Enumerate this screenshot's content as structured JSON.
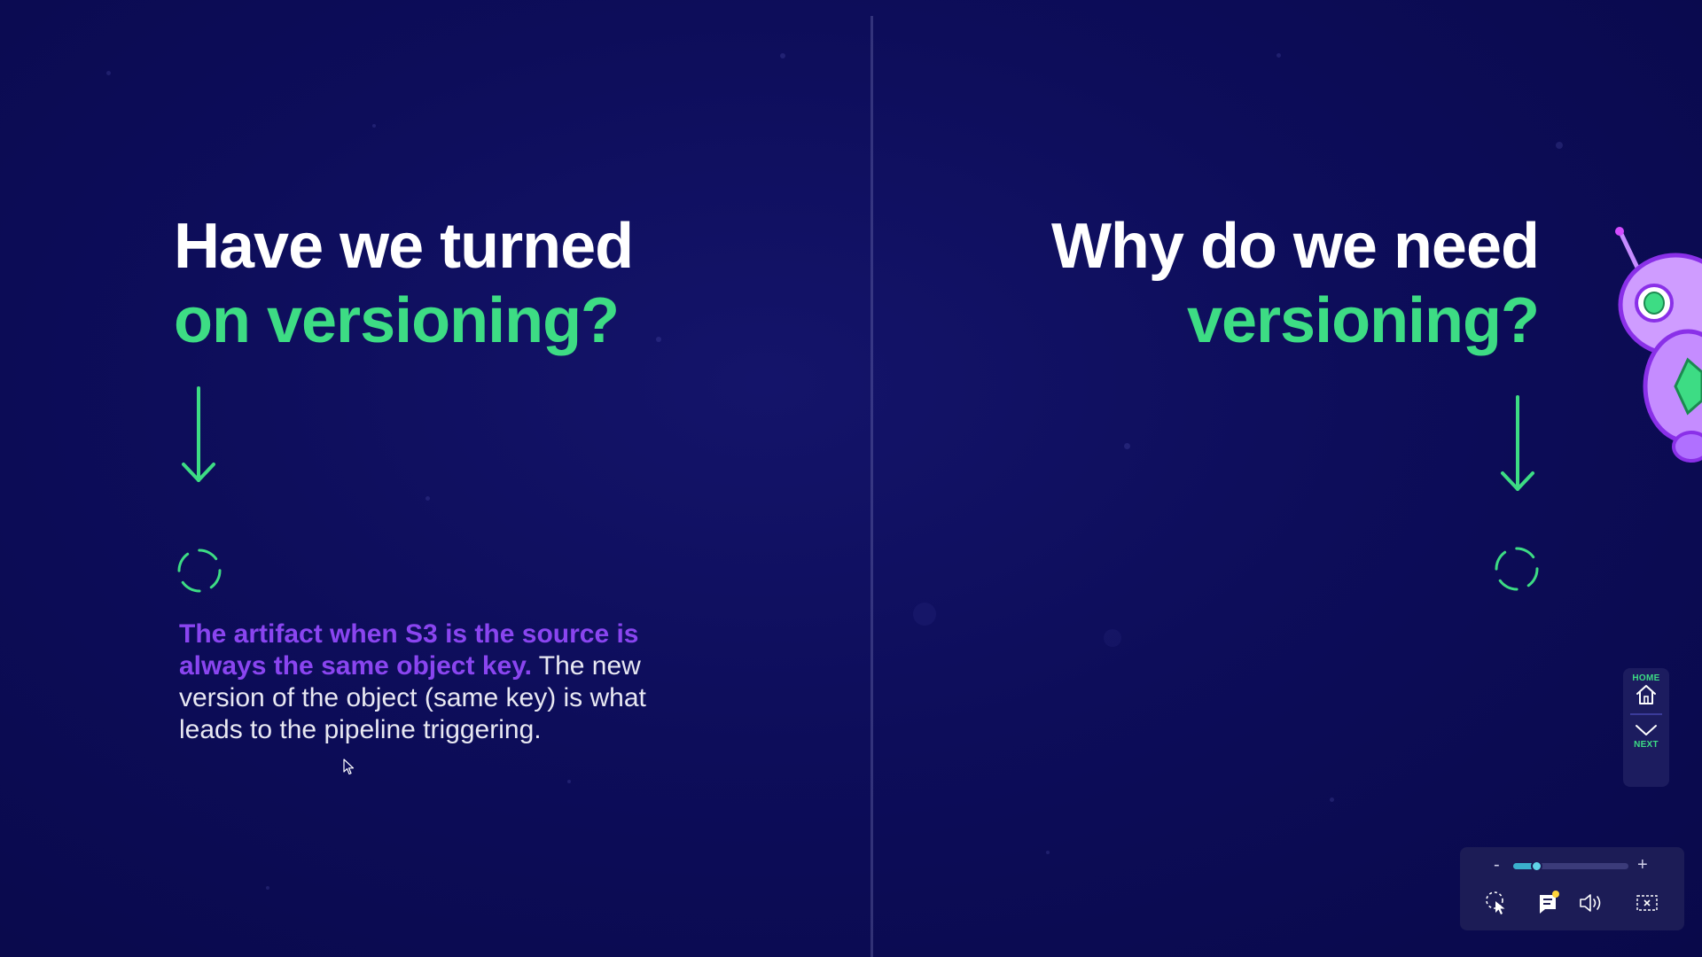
{
  "left_slide": {
    "title_line1": "Have we turned",
    "title_line2": "on versioning?",
    "body_highlight": "The artifact when S3 is the source is always the same object key.",
    "body_rest": " The new version of the object (same key) is what leads to the pipeline triggering."
  },
  "right_slide": {
    "title_line1": "Why do we need",
    "title_line2": "versioning?"
  },
  "nav": {
    "home_label": "HOME",
    "next_label": "NEXT"
  },
  "controls": {
    "zoom_minus": "-",
    "zoom_plus": "+",
    "zoom_level": 0.2
  },
  "colors": {
    "accent_green": "#3ddc84",
    "accent_purple": "#8a45f0",
    "background": "#0d0d5a"
  }
}
